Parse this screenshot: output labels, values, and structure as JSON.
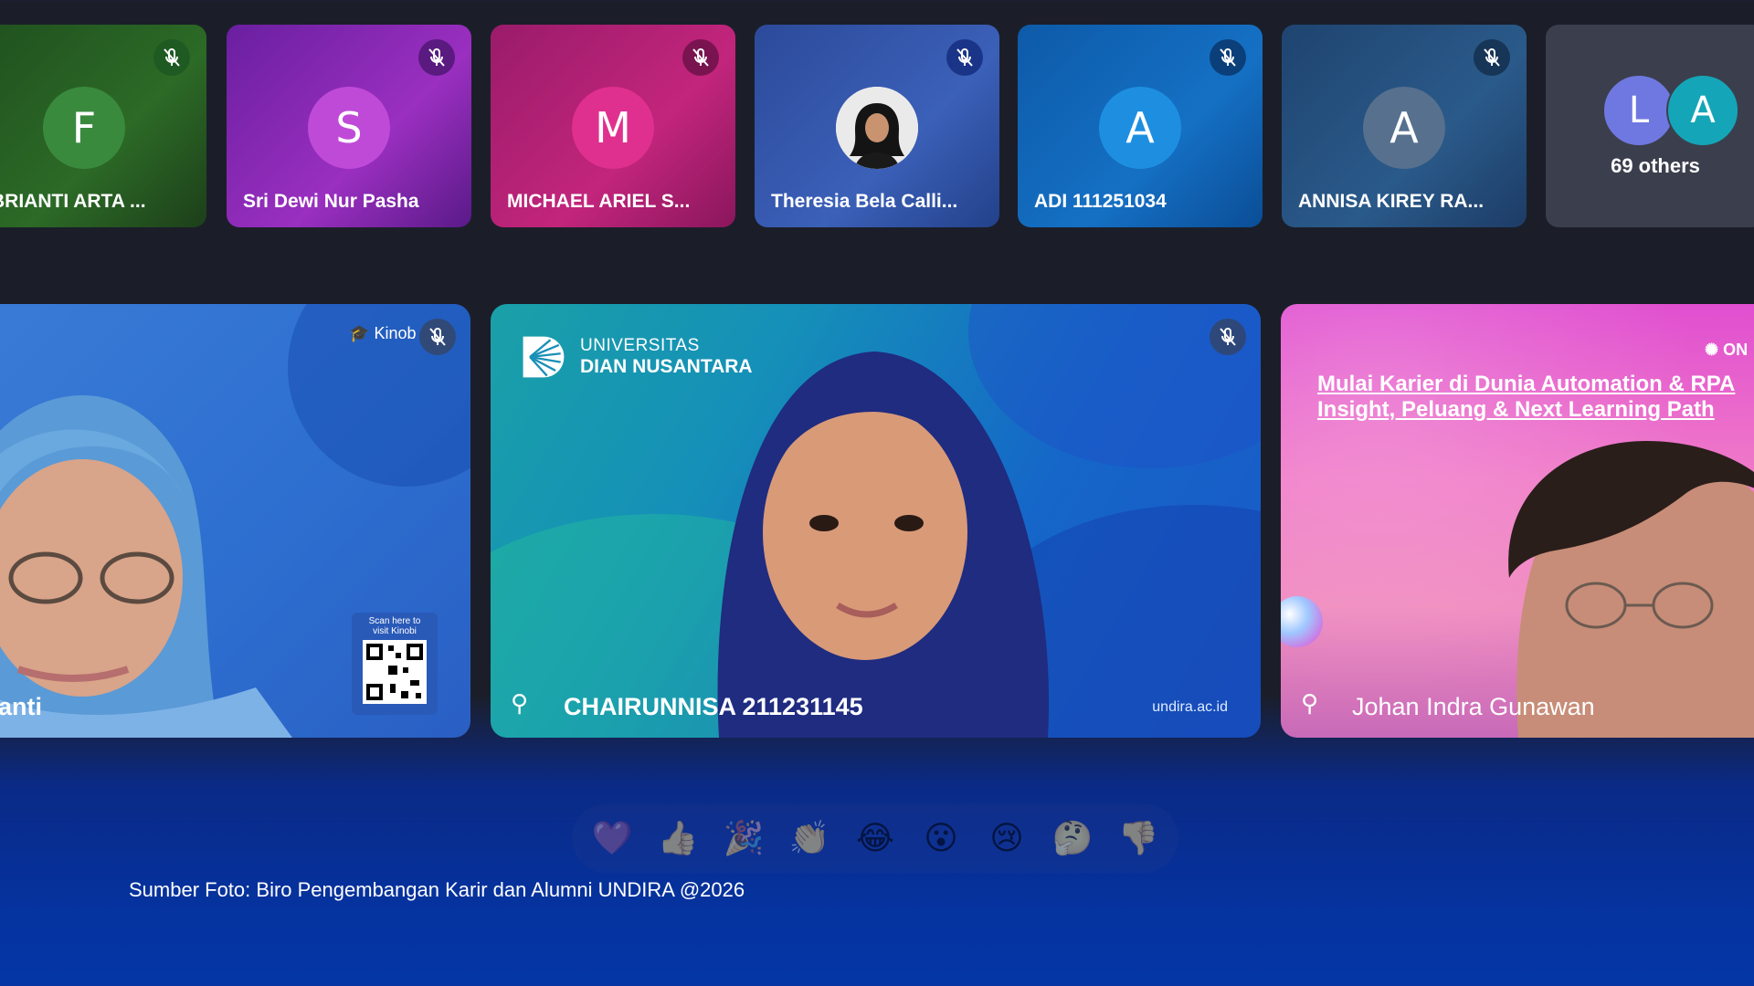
{
  "participants_strip": [
    {
      "initial": "F",
      "name": "EBRIANTI ARTA ...",
      "color": "#2e8b3a"
    },
    {
      "initial": "S",
      "name": "Sri Dewi Nur Pasha",
      "color": "#c048d8"
    },
    {
      "initial": "M",
      "name": "MICHAEL ARIEL S...",
      "color": "#e0308f"
    },
    {
      "initial": "",
      "name": "Theresia Bela Calli...",
      "color": "#f2f2f2"
    },
    {
      "initial": "A",
      "name": "ADI 111251034",
      "color": "#1e88e5"
    },
    {
      "initial": "A",
      "name": "ANNISA KIREY RA...",
      "color": "#546e8a"
    }
  ],
  "others": {
    "avatars": [
      "L",
      "A"
    ],
    "label": "69 others"
  },
  "main_tiles": {
    "left": {
      "name": "anti",
      "brand": "Kinob",
      "qr_text_1": "Scan here to",
      "qr_text_2": "visit Kinobi"
    },
    "center": {
      "name": "CHAIRUNNISA 211231145",
      "university_line1": "UNIVERSITAS",
      "university_line2": "DIAN NUSANTARA",
      "website": "undira.ac.id"
    },
    "right": {
      "name": "Johan Indra Gunawan",
      "banner_line1": "Mulai Karier di Dunia Automation & RPA",
      "banner_line2": "Insight, Peluang & Next Learning Path",
      "logo": "ON"
    }
  },
  "reactions": [
    "💜",
    "👍",
    "🎉",
    "👏",
    "😂",
    "😮",
    "😢",
    "🤔",
    "👎"
  ],
  "caption": "Sumber Foto: Biro Pengembangan Karir dan Alumni UNDIRA @2026"
}
